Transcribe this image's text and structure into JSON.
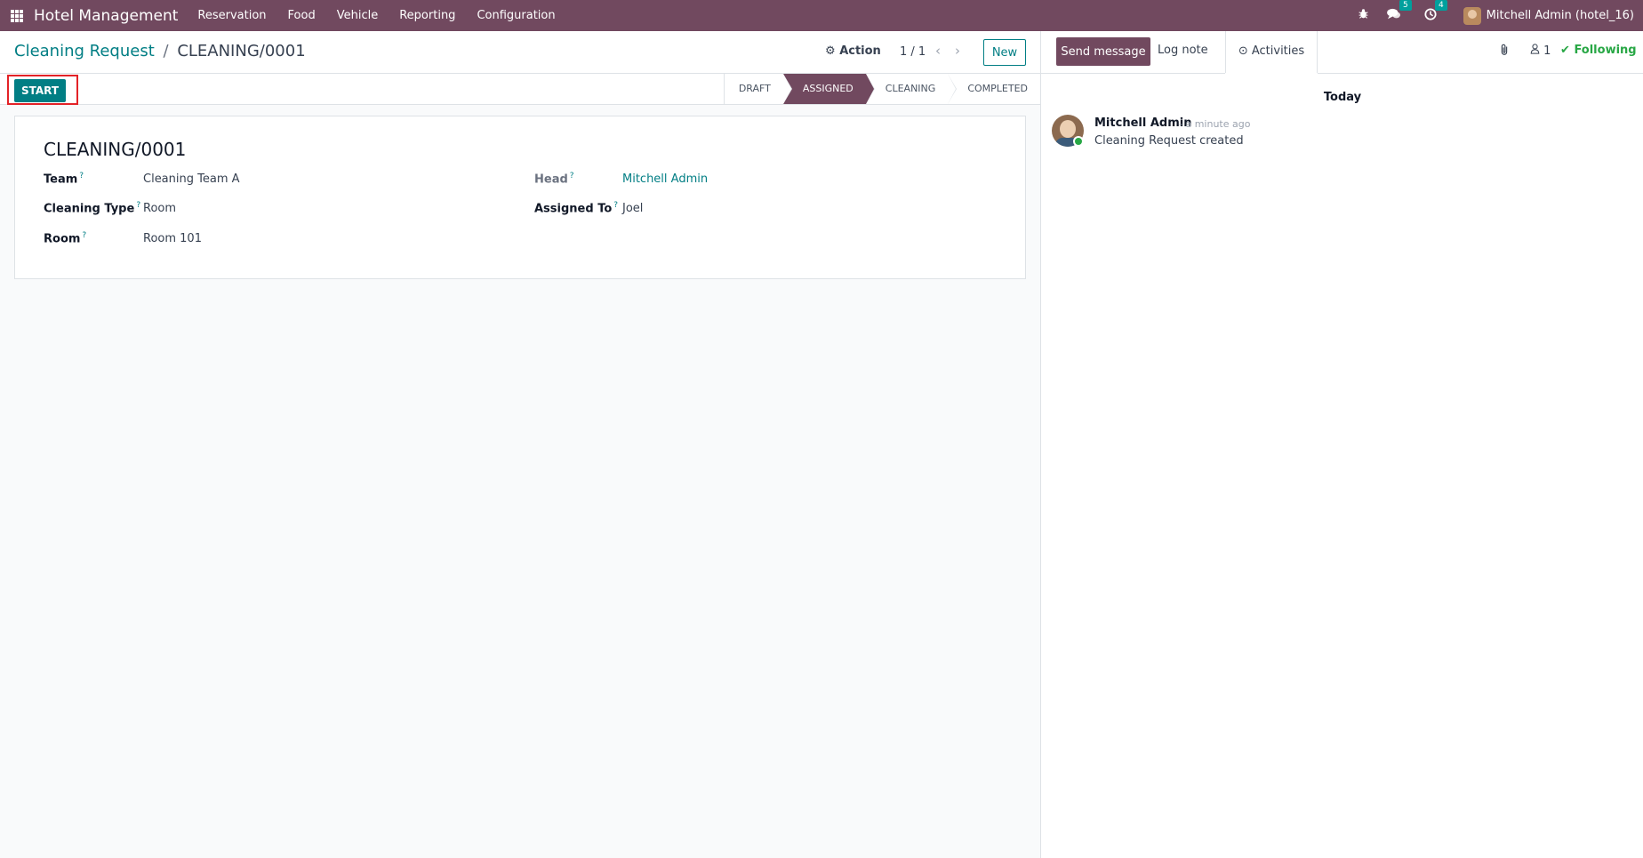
{
  "navbar": {
    "brand": "Hotel Management",
    "menu": [
      "Reservation",
      "Food",
      "Vehicle",
      "Reporting",
      "Configuration"
    ],
    "messages_count": "5",
    "activities_count": "4",
    "user": "Mitchell Admin (hotel_16)"
  },
  "breadcrumb": {
    "parent": "Cleaning Request",
    "separator": "/",
    "current": "CLEANING/0001"
  },
  "control": {
    "action_label": "Action",
    "pager": "1 / 1",
    "new_label": "New"
  },
  "statusbar": {
    "start_label": "START",
    "stages": [
      "DRAFT",
      "ASSIGNED",
      "CLEANING",
      "COMPLETED"
    ],
    "active_stage": "ASSIGNED"
  },
  "form": {
    "title": "CLEANING/0001",
    "help_mark": "?",
    "team_label": "Team",
    "team_value": "Cleaning Team A",
    "cleaning_type_label": "Cleaning Type",
    "cleaning_type_value": "Room",
    "room_label": "Room",
    "room_value": "Room 101",
    "head_label": "Head",
    "head_value": "Mitchell Admin",
    "assigned_to_label": "Assigned To",
    "assigned_to_value": "Joel"
  },
  "chatter": {
    "send_message": "Send message",
    "log_note": "Log note",
    "activities": "Activities",
    "followers_count": "1",
    "following": "Following",
    "today": "Today",
    "message": {
      "author": "Mitchell Admin",
      "time": "- a minute ago",
      "body": "Cleaning Request created"
    }
  },
  "colors": {
    "navbar": "#71495f",
    "accent": "#017e84",
    "active_stage": "#71495f",
    "following": "#28a745",
    "highlight_outline": "#e32227"
  }
}
